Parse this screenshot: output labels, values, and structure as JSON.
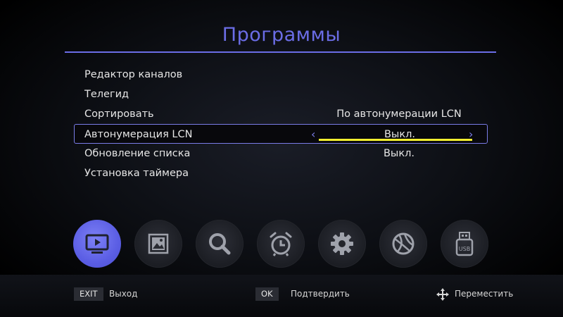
{
  "header": {
    "title": "Программы"
  },
  "menu": {
    "items": [
      {
        "label": "Редактор каналов",
        "value": ""
      },
      {
        "label": "Телегид",
        "value": ""
      },
      {
        "label": "Сортировать",
        "value": "По автонумерации LCN"
      },
      {
        "label": "Автонумерация LCN",
        "value": "Выкл."
      },
      {
        "label": "Обновление списка",
        "value": "Выкл."
      },
      {
        "label": "Установка таймера",
        "value": ""
      }
    ],
    "selected_index": 3
  },
  "icons": [
    {
      "name": "tv-icon",
      "active": true
    },
    {
      "name": "picture-icon",
      "active": false
    },
    {
      "name": "search-icon",
      "active": false
    },
    {
      "name": "alarm-clock-icon",
      "active": false
    },
    {
      "name": "gear-icon",
      "active": false
    },
    {
      "name": "globe-ball-icon",
      "active": false
    },
    {
      "name": "usb-icon",
      "active": false
    }
  ],
  "footer": {
    "exit_key": "EXIT",
    "exit_label": "Выход",
    "ok_key": "OK",
    "ok_label": "Подтвердить",
    "move_label": "Переместить"
  },
  "colors": {
    "accent": "#6b6de6",
    "highlight_underline": "#f2ee2f",
    "active_icon": "#5b5ee4"
  }
}
